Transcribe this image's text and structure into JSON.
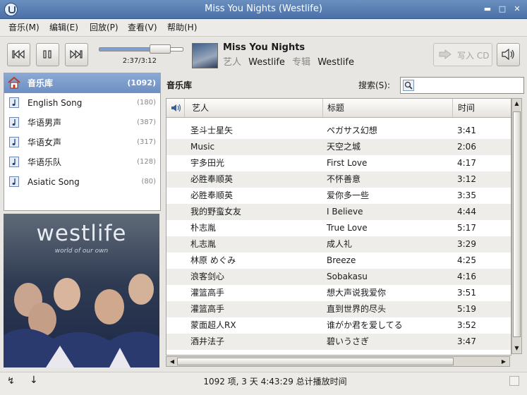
{
  "window": {
    "title": "Miss You Nights (Westlife)"
  },
  "menu": [
    "音乐(M)",
    "编辑(E)",
    "回放(P)",
    "查看(V)",
    "帮助(H)"
  ],
  "player": {
    "time": "2:37/3:12",
    "progress": 0.82,
    "now_playing_title": "Miss You Nights",
    "artist_label": "艺人",
    "artist": "Westlife",
    "album_label": "专辑",
    "album": "Westlife",
    "burn_label": "写入 CD"
  },
  "sidebar": {
    "items": [
      {
        "label": "音乐库",
        "count": "(1092)"
      },
      {
        "label": "English Song",
        "count": "(180)"
      },
      {
        "label": "华语男声",
        "count": "(387)"
      },
      {
        "label": "华语女声",
        "count": "(317)"
      },
      {
        "label": "华语乐队",
        "count": "(128)"
      },
      {
        "label": "Asiatic Song",
        "count": "(80)"
      }
    ]
  },
  "album_art": {
    "brand": "westlife",
    "subtitle": "world of our own"
  },
  "main": {
    "title": "音乐库",
    "search_label": "搜索(S):"
  },
  "table": {
    "columns": [
      "艺人",
      "标题",
      "时间"
    ],
    "rows": [
      [
        "圣斗士星矢",
        "ペガサス幻想",
        "3:41"
      ],
      [
        "Music",
        "天空之城",
        "2:06"
      ],
      [
        "宇多田光",
        "First Love",
        "4:17"
      ],
      [
        "必胜奉顺英",
        "不怀善意",
        "3:12"
      ],
      [
        "必胜奉顺英",
        "爱你多一些",
        "3:35"
      ],
      [
        "我的野蛮女友",
        "I Believe",
        "4:44"
      ],
      [
        "朴志胤",
        "True Love",
        "5:17"
      ],
      [
        "札志胤",
        "成人礼",
        "3:29"
      ],
      [
        "林原 めぐみ",
        "Breeze",
        "4:25"
      ],
      [
        "浪客剑心",
        "Sobakasu",
        "4:16"
      ],
      [
        "灌篮高手",
        "想大声说我爱你",
        "3:51"
      ],
      [
        "灌篮高手",
        "直到世界的尽头",
        "5:19"
      ],
      [
        "蒙面超人RX",
        "谁がか君を爱してる",
        "3:52"
      ],
      [
        "酒井法子",
        "碧いうさぎ",
        "3:47"
      ]
    ]
  },
  "status": {
    "summary": "1092 项, 3 天 4:43:29 总计播放时间"
  }
}
